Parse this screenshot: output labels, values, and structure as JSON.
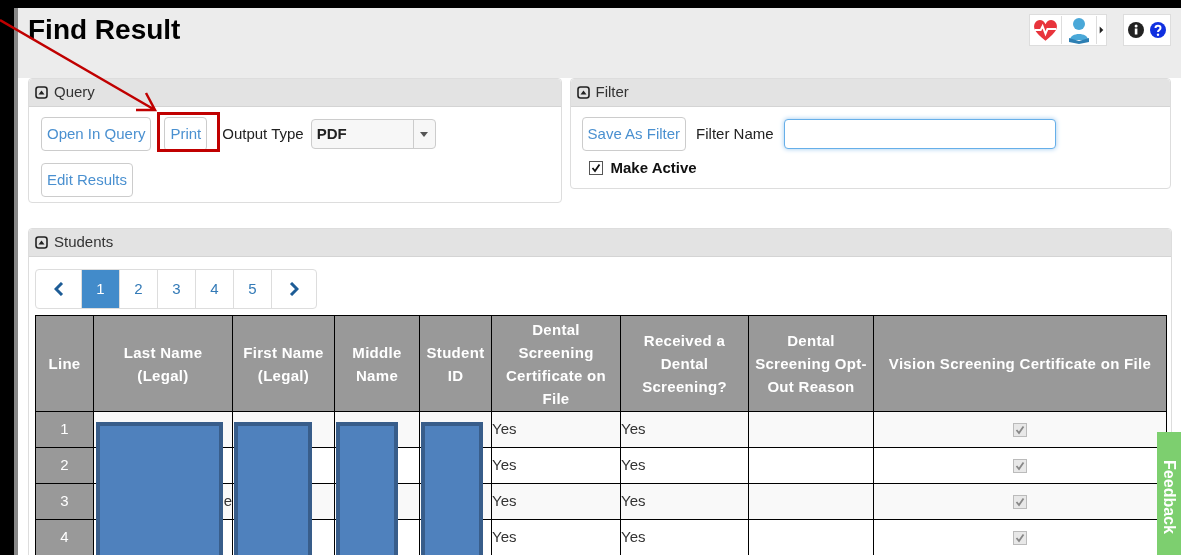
{
  "title": "Find Result",
  "query": {
    "heading": "Query",
    "buttons": [
      "Open In Query",
      "Print",
      "Edit Results"
    ],
    "output_label": "Output Type",
    "output_value": "PDF"
  },
  "filter": {
    "heading": "Filter",
    "save_button": "Save As Filter",
    "name_label": "Filter Name",
    "make_active": {
      "label": "Make Active",
      "checked": true
    }
  },
  "students": {
    "heading": "Students",
    "pages": [
      {
        "label": "1",
        "selected": true
      },
      {
        "label": "2",
        "selected": false
      },
      {
        "label": "3",
        "selected": false
      },
      {
        "label": "4",
        "selected": false
      },
      {
        "label": "5",
        "selected": false
      }
    ],
    "columns": [
      "Line",
      "Last Name (Legal)",
      "First Name (Legal)",
      "Middle Name",
      "Student ID",
      "Dental Screening Certificate on File",
      "Received a Dental Screening?",
      "Dental Screening Opt-Out Reason",
      "Vision Screening Certificate on File"
    ],
    "rows": [
      {
        "line": "1",
        "dental_certificate": "Yes",
        "received_dental": "Yes",
        "vision_certificate": true
      },
      {
        "line": "2",
        "dental_certificate": "Yes",
        "received_dental": "Yes",
        "vision_certificate": true
      },
      {
        "line": "3",
        "last_name": "e",
        "dental_certificate": "Yes",
        "received_dental": "Yes",
        "vision_certificate": true
      },
      {
        "line": "4",
        "dental_certificate": "Yes",
        "received_dental": "Yes",
        "vision_certificate": true
      }
    ]
  },
  "feedback_tab": "Feedback"
}
